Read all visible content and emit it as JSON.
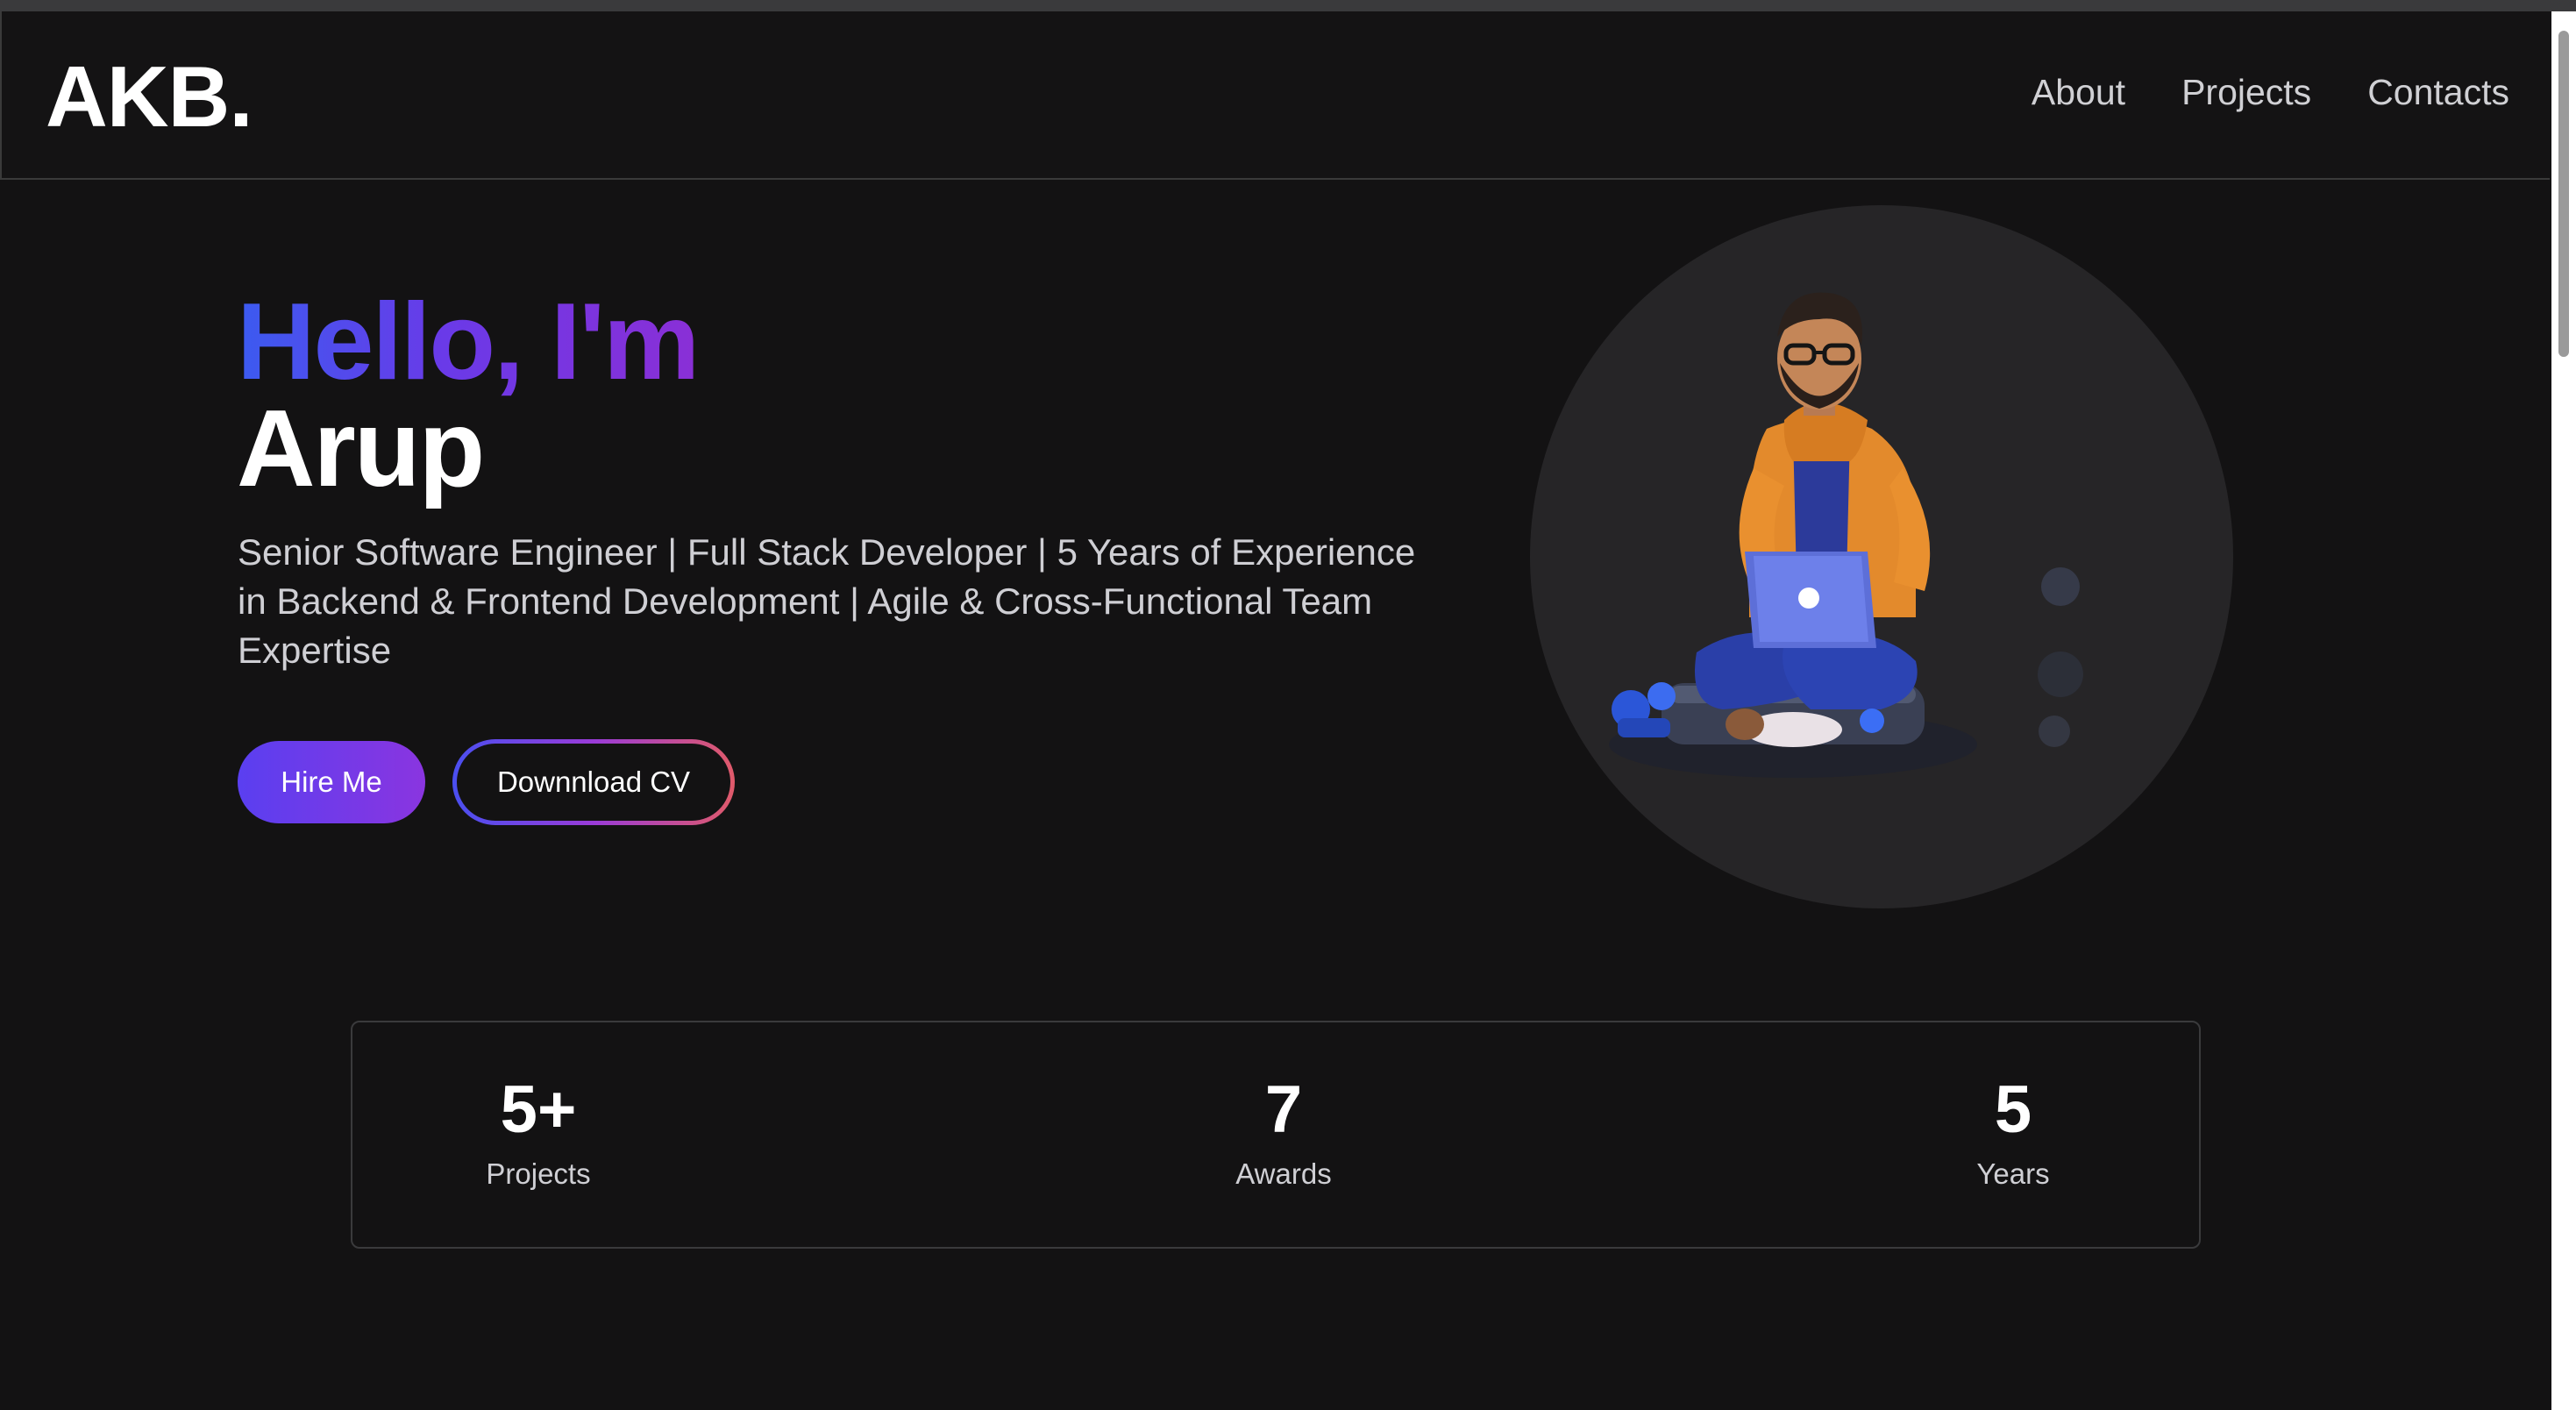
{
  "header": {
    "logo": "AKB.",
    "nav": [
      {
        "label": "About"
      },
      {
        "label": "Projects"
      },
      {
        "label": "Contacts"
      }
    ]
  },
  "hero": {
    "greeting": "Hello, I'm",
    "name": "Arup",
    "description": "Senior Software Engineer | Full Stack Developer | 5 Years of Experience in Backend & Frontend Development | Agile & Cross-Functional Team Expertise",
    "hire_label": "Hire Me",
    "cv_label": "Downnload CV",
    "avatar_icon": "developer-avatar-illustration"
  },
  "stats": [
    {
      "value": "5+",
      "label": "Projects"
    },
    {
      "value": "7",
      "label": "Awards"
    },
    {
      "value": "5",
      "label": "Years"
    }
  ],
  "colors": {
    "background": "#131213",
    "gradient_start": "#3b5bf0",
    "gradient_end": "#8a2fd6",
    "text_muted": "#cfcfd4",
    "avatar_bg": "#262527"
  }
}
